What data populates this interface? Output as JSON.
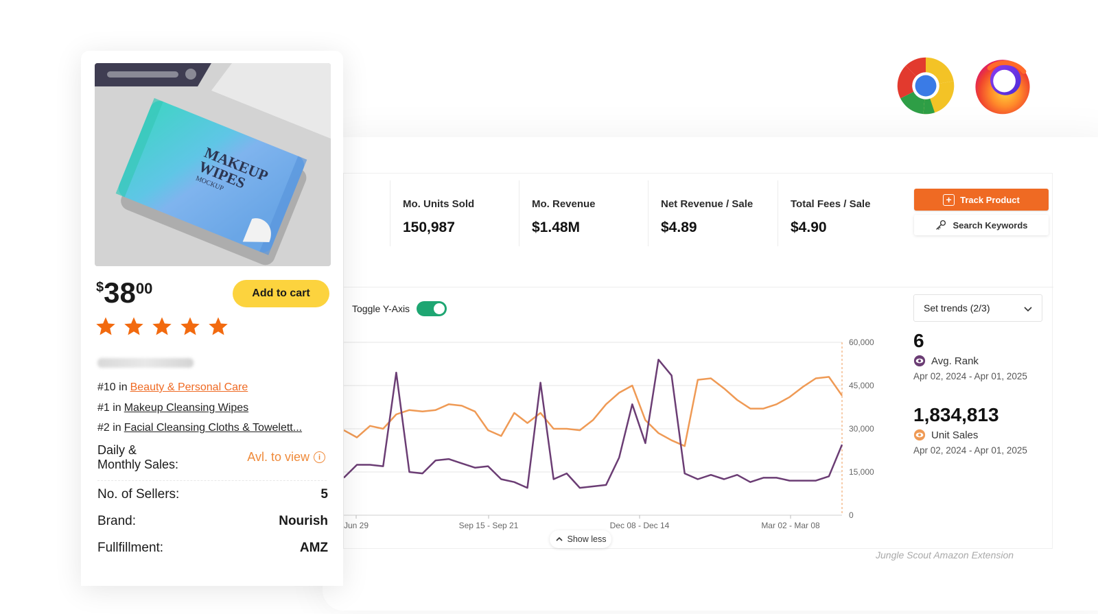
{
  "card": {
    "price_currency": "$",
    "price_whole": "38",
    "price_cents": "00",
    "add_to_cart": "Add to cart",
    "rating": 5,
    "ranks": [
      {
        "prefix": "#10 in",
        "category": "Beauty & Personal Care"
      },
      {
        "prefix": "#1 in",
        "category": "Makeup Cleansing Wipes"
      },
      {
        "prefix": "#2 in",
        "category": "Facial Cleansing Cloths & Towelett..."
      }
    ],
    "daily_label_1": "Daily &",
    "daily_label_2": "Monthly Sales:",
    "avl_text": "Avl. to view",
    "sellers_label": "No. of Sellers:",
    "sellers_value": "5",
    "brand_label": "Brand:",
    "brand_value": "Nourish",
    "fulfillment_label": "Fullfillment:",
    "fulfillment_value": "AMZ",
    "image_text_1": "MAKEUP",
    "image_text_2": "WIPES",
    "image_text_3": "MOCKUP"
  },
  "metrics": [
    {
      "label": "Mo. Units Sold",
      "value": "150,987"
    },
    {
      "label": "Mo. Revenue",
      "value": "$1.48M"
    },
    {
      "label": "Net Revenue / Sale",
      "value": "$4.89"
    },
    {
      "label": "Total Fees / Sale",
      "value": "$4.90"
    }
  ],
  "actions": {
    "track_product": "Track Product",
    "search_keywords": "Search Keywords"
  },
  "controls": {
    "toggle_label": "Toggle Y-Axis",
    "toggle_on": true,
    "trends_select": "Set trends (2/3)",
    "show_less": "Show less"
  },
  "stats": [
    {
      "value": "6",
      "label": "Avg. Rank",
      "range": "Apr 02, 2024 - Apr 01, 2025",
      "color": "#6b3d74"
    },
    {
      "value": "1,834,813",
      "label": "Unit Sales",
      "range": "Apr 02, 2024 - Apr 01, 2025",
      "color": "#ef9a55"
    }
  ],
  "caption": "Jungle Scout Amazon Extension",
  "colors": {
    "accent_orange": "#ef6a23",
    "rank_line": "#6b3d74",
    "sales_line": "#ef9a55",
    "toggle_green": "#1ea672",
    "cart_yellow": "#fcd33e"
  },
  "chart_data": {
    "type": "line",
    "x_tick_labels": [
      "Jun 29",
      "Sep 15 - Sep 21",
      "Dec 08 - Dec 14",
      "Mar 02 - Mar 08"
    ],
    "y_right_ticks": [
      "60,000",
      "45,000",
      "30,000",
      "15,000",
      "0"
    ],
    "ylim": [
      0,
      60000
    ],
    "series": [
      {
        "name": "Unit Sales",
        "color": "#ef9a55",
        "values": [
          29500,
          27000,
          31000,
          30000,
          35000,
          36500,
          36000,
          36500,
          38500,
          38000,
          36000,
          29500,
          27500,
          35500,
          32000,
          35500,
          30000,
          30000,
          29500,
          33000,
          38500,
          42500,
          45000,
          33000,
          28500,
          26000,
          24000,
          47000,
          47500,
          44000,
          40000,
          37000,
          37000,
          38500,
          41000,
          44500,
          47500,
          48000,
          41500
        ]
      },
      {
        "name": "Avg. Rank",
        "color": "#6b3d74",
        "values": [
          13000,
          17500,
          17500,
          17000,
          49500,
          15000,
          14500,
          19000,
          19500,
          18000,
          16500,
          17000,
          12500,
          11500,
          9500,
          46000,
          12500,
          14500,
          9500,
          10000,
          10500,
          20000,
          38500,
          25000,
          54000,
          48500,
          14500,
          12500,
          14000,
          12500,
          14000,
          11500,
          13000,
          13000,
          12000,
          12000,
          12000,
          13500,
          24500
        ]
      }
    ]
  }
}
